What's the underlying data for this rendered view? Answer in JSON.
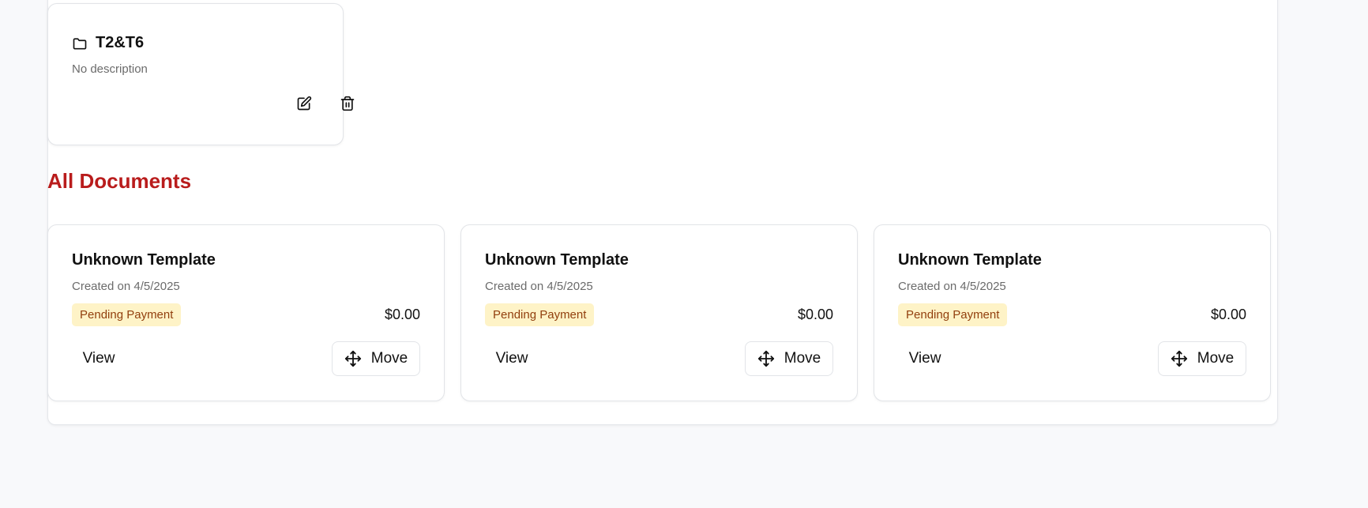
{
  "folder": {
    "name": "T2&T6",
    "description": "No description",
    "icon": "folder-icon",
    "actions": [
      "edit-icon",
      "trash-icon"
    ]
  },
  "section": {
    "title": "All Documents"
  },
  "documents": [
    {
      "title": "Unknown Template",
      "created": "Created on 4/5/2025",
      "status": "Pending Payment",
      "price": "$0.00",
      "view_label": "View",
      "move_label": "Move"
    },
    {
      "title": "Unknown Template",
      "created": "Created on 4/5/2025",
      "status": "Pending Payment",
      "price": "$0.00",
      "view_label": "View",
      "move_label": "Move"
    },
    {
      "title": "Unknown Template",
      "created": "Created on 4/5/2025",
      "status": "Pending Payment",
      "price": "$0.00",
      "view_label": "View",
      "move_label": "Move"
    }
  ],
  "colors": {
    "section_title": "#b91c1c",
    "badge_bg": "#fef3c7",
    "badge_text": "#92400e",
    "page_bg": "#f8f9fb"
  }
}
